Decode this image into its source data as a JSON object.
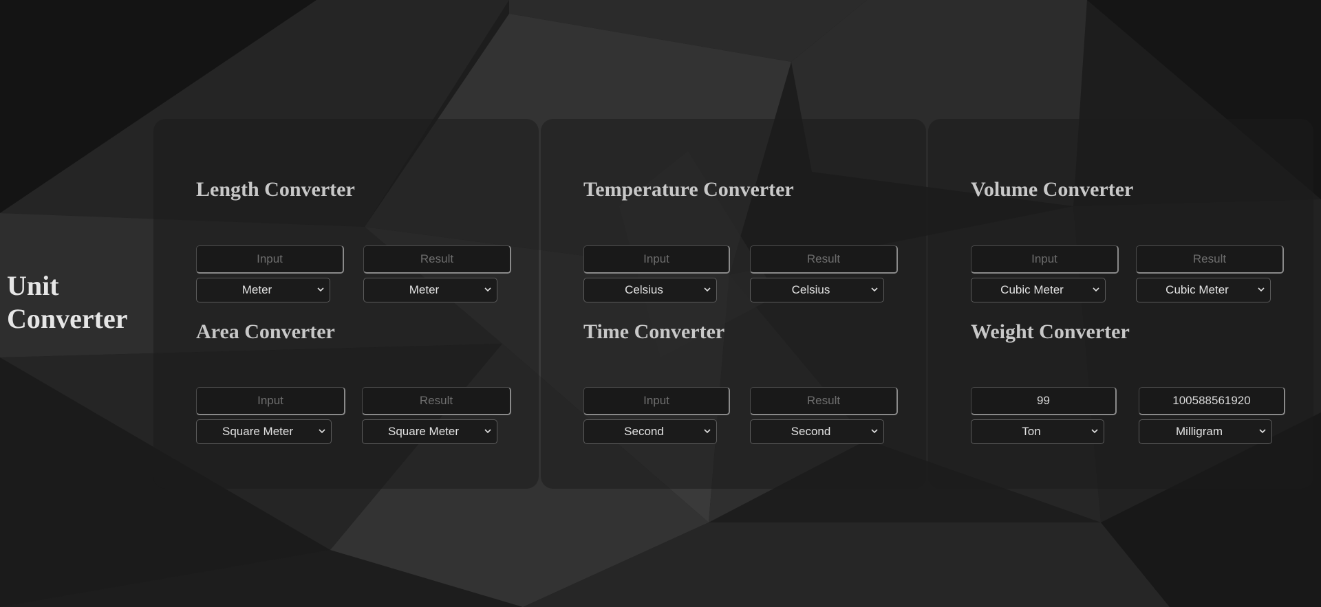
{
  "page": {
    "title": "Unit Converter",
    "colors": {
      "background": "#1c1c1c",
      "panel": "#2a2a2a",
      "heading": "#c8c8c8",
      "field": "#191919"
    }
  },
  "converters": [
    {
      "name": "length",
      "title": "Length Converter",
      "input": {
        "placeholder": "Input",
        "value": ""
      },
      "result": {
        "placeholder": "Result",
        "value": ""
      },
      "from_unit": "Meter",
      "to_unit": "Meter"
    },
    {
      "name": "temperature",
      "title": "Temperature Converter",
      "input": {
        "placeholder": "Input",
        "value": ""
      },
      "result": {
        "placeholder": "Result",
        "value": ""
      },
      "from_unit": "Celsius",
      "to_unit": "Celsius"
    },
    {
      "name": "volume",
      "title": "Volume Converter",
      "input": {
        "placeholder": "Input",
        "value": ""
      },
      "result": {
        "placeholder": "Result",
        "value": ""
      },
      "from_unit": "Cubic Meter",
      "to_unit": "Cubic Meter"
    },
    {
      "name": "area",
      "title": "Area Converter",
      "input": {
        "placeholder": "Input",
        "value": ""
      },
      "result": {
        "placeholder": "Result",
        "value": ""
      },
      "from_unit": "Square Meter",
      "to_unit": "Square Meter"
    },
    {
      "name": "time",
      "title": "Time Converter",
      "input": {
        "placeholder": "Input",
        "value": ""
      },
      "result": {
        "placeholder": "Result",
        "value": ""
      },
      "from_unit": "Second",
      "to_unit": "Second"
    },
    {
      "name": "weight",
      "title": "Weight Converter",
      "input": {
        "placeholder": "Input",
        "value": "99"
      },
      "result": {
        "placeholder": "Result",
        "value": "100588561920"
      },
      "from_unit": "Ton",
      "to_unit": "Milligram"
    }
  ],
  "icons": {
    "dropdown": "chevron-down-icon"
  }
}
